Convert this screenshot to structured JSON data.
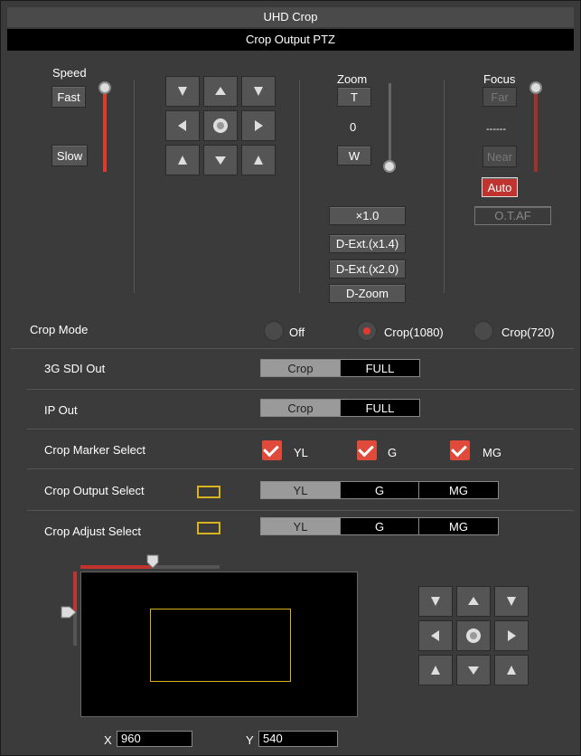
{
  "header": {
    "title": "UHD Crop",
    "subtitle": "Crop Output PTZ"
  },
  "speed": {
    "label": "Speed",
    "fast": "Fast",
    "slow": "Slow"
  },
  "zoom": {
    "label": "Zoom",
    "tele": "T",
    "value": "0",
    "wide": "W",
    "presets": [
      "×1.0",
      "D-Ext.(x1.4)",
      "D-Ext.(x2.0)",
      "D-Zoom"
    ]
  },
  "focus": {
    "label": "Focus",
    "far": "Far",
    "value": "------",
    "near": "Near",
    "auto": "Auto",
    "otaf": "O.T.AF"
  },
  "crop_mode": {
    "label": "Crop Mode",
    "options": [
      "Off",
      "Crop(1080)",
      "Crop(720)"
    ],
    "selected": "Crop(1080)"
  },
  "sdi_out": {
    "label": "3G SDI Out",
    "options": [
      "Crop",
      "FULL"
    ],
    "selected": "Crop"
  },
  "ip_out": {
    "label": "IP Out",
    "options": [
      "Crop",
      "FULL"
    ],
    "selected": "Crop"
  },
  "marker_select": {
    "label": "Crop Marker Select",
    "options": [
      "YL",
      "G",
      "MG"
    ]
  },
  "output_select": {
    "label": "Crop Output Select",
    "options": [
      "YL",
      "G",
      "MG"
    ],
    "selected": "YL"
  },
  "adjust_select": {
    "label": "Crop Adjust Select",
    "options": [
      "YL",
      "G",
      "MG"
    ],
    "selected": "YL"
  },
  "position": {
    "x_label": "X",
    "x_value": "960",
    "y_label": "Y",
    "y_value": "540"
  },
  "colors": {
    "accent_red": "#e03a2e",
    "marker_yellow": "#d8b320",
    "panel_bg": "#3b3b3b"
  },
  "icons": [
    "arrow-up-left-icon",
    "arrow-up-icon",
    "arrow-up-right-icon",
    "arrow-left-icon",
    "home-dot-icon",
    "arrow-right-icon",
    "arrow-down-left-icon",
    "arrow-down-icon",
    "arrow-down-right-icon"
  ]
}
